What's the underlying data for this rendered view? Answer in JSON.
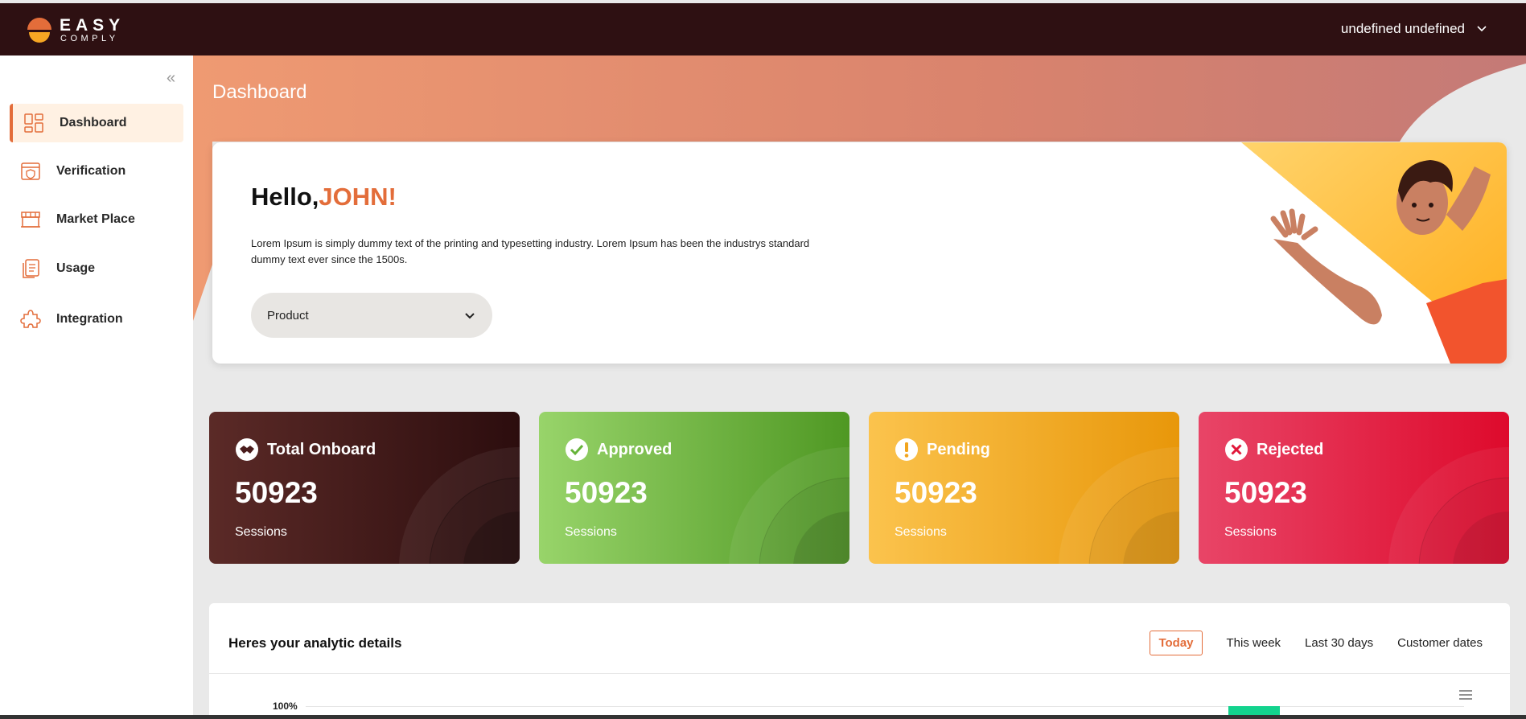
{
  "header": {
    "logo_line1": "EASY",
    "logo_line2": "COMPLY",
    "user_name": "undefined undefined"
  },
  "sidebar": {
    "items": [
      {
        "label": "Dashboard",
        "icon": "dashboard-grid-icon",
        "active": true
      },
      {
        "label": "Verification",
        "icon": "verification-shield-icon",
        "active": false
      },
      {
        "label": "Market Place",
        "icon": "storefront-icon",
        "active": false
      },
      {
        "label": "Usage",
        "icon": "document-stack-icon",
        "active": false
      },
      {
        "label": "Integration",
        "icon": "puzzle-icon",
        "active": false
      }
    ]
  },
  "main": {
    "page_title": "Dashboard",
    "welcome": {
      "greeting": "Hello,",
      "name": "JOHN!",
      "text": "Lorem Ipsum is simply dummy text of the printing and typesetting industry. Lorem Ipsum has been the industrys standard dummy text ever since the 1500s.",
      "product_select": "Product"
    },
    "stats": [
      {
        "title": "Total Onboard",
        "value": "50923",
        "label": "Sessions",
        "icon": "handshake-icon",
        "color": "#4a1c1c"
      },
      {
        "title": "Approved",
        "value": "50923",
        "label": "Sessions",
        "icon": "check-circle-icon",
        "color": "#66b33a"
      },
      {
        "title": "Pending",
        "value": "50923",
        "label": "Sessions",
        "icon": "exclamation-circle-icon",
        "color": "#f2a51e"
      },
      {
        "title": "Rejected",
        "value": "50923",
        "label": "Sessions",
        "icon": "close-circle-icon",
        "color": "#e1173a"
      }
    ],
    "analytics": {
      "title": "Heres your analytic details",
      "ranges": [
        "Today",
        "This week",
        "Last 30 days",
        "Customer dates"
      ],
      "active_range": "Today",
      "axis_top_label": "100%"
    }
  },
  "colors": {
    "accent": "#e36d3a",
    "topbar": "#2e1012"
  }
}
